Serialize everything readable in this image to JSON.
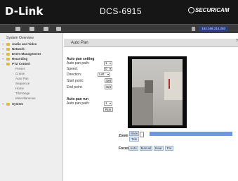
{
  "header": {
    "brand": "D-Link",
    "model": "DCS-6915",
    "partner": "SECURICAM",
    "ip": "192.168.214.250"
  },
  "sidebar": {
    "title": "System Overview",
    "items": [
      {
        "label": "Audio and Video"
      },
      {
        "label": "Network"
      },
      {
        "label": "Event Management"
      },
      {
        "label": "Recording"
      },
      {
        "label": "PTZ Control"
      }
    ],
    "subitems": [
      {
        "label": "Preset"
      },
      {
        "label": "Cruise"
      },
      {
        "label": "Auto Pan"
      },
      {
        "label": "Sequence"
      },
      {
        "label": "Home"
      },
      {
        "label": "Tilt Range"
      },
      {
        "label": "Miscellaneous"
      }
    ],
    "last": {
      "label": "System"
    }
  },
  "main": {
    "tab_title": "Auto Pan",
    "tab_right": "?",
    "setting": {
      "title": "Auto pan setting",
      "path_label": "Auto pan path:",
      "path_value": "1",
      "speed_label": "Speed:",
      "speed_value": "0",
      "direction_label": "Direction:",
      "direction_value": "Left",
      "start_label": "Start point:",
      "start_btn": "Set",
      "end_label": "End point:",
      "end_btn": "Set"
    },
    "run": {
      "title": "Auto pan run",
      "path_label": "Auto pan path:",
      "path_value": "1",
      "run_btn": "Run"
    },
    "zoom": {
      "label": "Zoom",
      "wide_btn": "Wide",
      "tele_btn": "Tele",
      "level": 0.0
    },
    "focus": {
      "label": "Focus",
      "buttons": [
        "Auto",
        "Manual",
        "Near",
        "Far"
      ]
    }
  }
}
